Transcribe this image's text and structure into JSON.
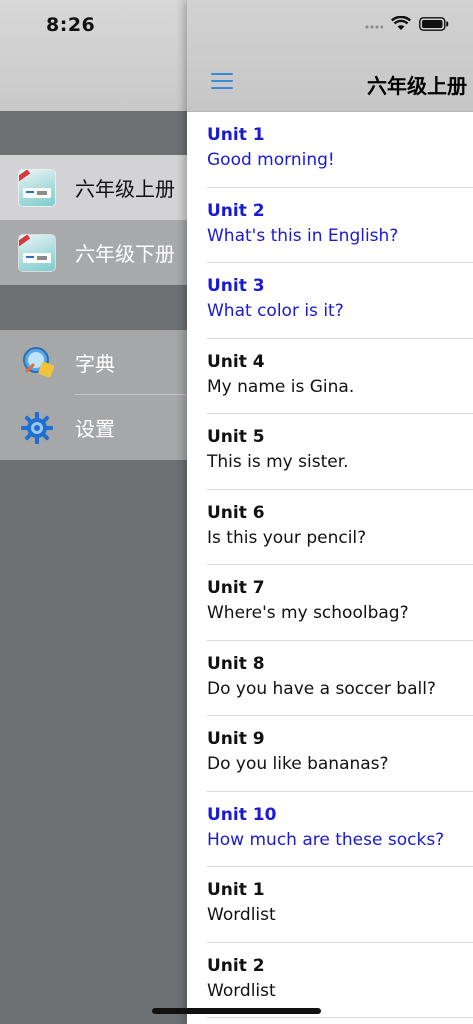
{
  "status_bar": {
    "time": "8:26"
  },
  "drawer": {
    "books": [
      {
        "label": "六年级上册",
        "icon": "book-cover-icon"
      },
      {
        "label": "六年级下册",
        "icon": "book-cover-icon"
      }
    ],
    "tools": [
      {
        "label": "字典",
        "icon": "dictionary-icon"
      },
      {
        "label": "设置",
        "icon": "gear-icon"
      }
    ]
  },
  "header": {
    "title": "六年级上册",
    "menu_icon": "hamburger-menu-icon"
  },
  "colors": {
    "highlight_text": "#1a1ad6",
    "normal_text": "#111111",
    "menu_accent": "#3b8ad9"
  },
  "units": [
    {
      "title": "Unit 1",
      "subtitle": "Good morning!",
      "highlighted": true
    },
    {
      "title": "Unit 2",
      "subtitle": "What's this in English?",
      "highlighted": true
    },
    {
      "title": "Unit 3",
      "subtitle": "What color is it?",
      "highlighted": true
    },
    {
      "title": "Unit 4",
      "subtitle": "My name is Gina.",
      "highlighted": false
    },
    {
      "title": "Unit 5",
      "subtitle": "This is my sister.",
      "highlighted": false
    },
    {
      "title": "Unit 6",
      "subtitle": "Is this your pencil?",
      "highlighted": false
    },
    {
      "title": "Unit 7",
      "subtitle": "Where's my schoolbag?",
      "highlighted": false
    },
    {
      "title": "Unit 8",
      "subtitle": "Do you have a soccer ball?",
      "highlighted": false
    },
    {
      "title": "Unit 9",
      "subtitle": "Do you like bananas?",
      "highlighted": false
    },
    {
      "title": "Unit 10",
      "subtitle": "How much are these socks?",
      "highlighted": true
    },
    {
      "title": "Unit 1",
      "subtitle": "Wordlist",
      "highlighted": false
    },
    {
      "title": "Unit 2",
      "subtitle": "Wordlist",
      "highlighted": false
    }
  ]
}
